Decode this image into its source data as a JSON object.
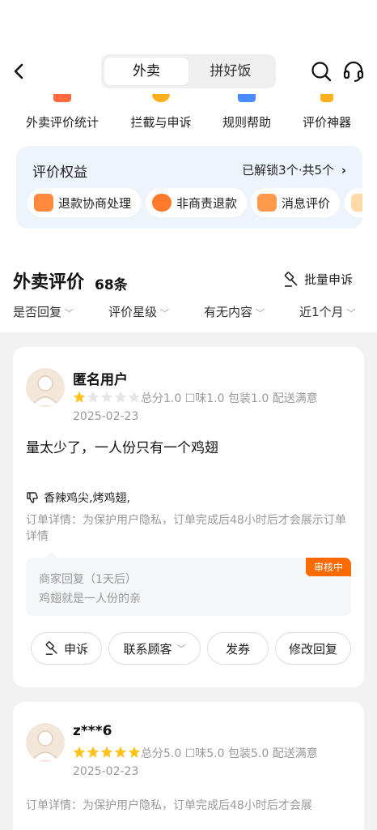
{
  "header": {
    "tabs": [
      {
        "label": "外卖",
        "active": true
      },
      {
        "label": "拼好饭",
        "active": false
      }
    ]
  },
  "quick_links": [
    {
      "label": "外卖评价统计",
      "icon": "stats-icon",
      "color": "#ff6a3d"
    },
    {
      "label": "拦截与申诉",
      "icon": "shield-icon",
      "color": "#ffb020"
    },
    {
      "label": "规则帮助",
      "icon": "book-icon",
      "color": "#4a8cff"
    },
    {
      "label": "评价神器",
      "icon": "star-icon",
      "color": "#ffb020"
    }
  ],
  "benefits": {
    "title": "评价权益",
    "status": "已解锁3个·共5个",
    "chips": [
      {
        "label": "退款协商处理",
        "icon": "refund-negotiation-icon"
      },
      {
        "label": "非商责退款",
        "icon": "refund-icon"
      },
      {
        "label": "消息评价",
        "icon": "message-icon"
      }
    ]
  },
  "section": {
    "title": "外卖评价",
    "count": "68条",
    "batch_label": "批量申诉"
  },
  "filters": [
    "是否回复",
    "评价星级",
    "有无内容",
    "近1个月"
  ],
  "reviews": [
    {
      "user": "匿名用户",
      "rating": 1,
      "scores": "总分1.0   ☐味1.0   包装1.0   配送满意",
      "date": "2025-02-23",
      "content": "量太少了，一人份只有一个鸡翅",
      "dislike": "香辣鸡尖,烤鸡翅,",
      "order_detail": "订单详情：为保护用户隐私，订单完成后48小时后才会展示订单详情",
      "reply": {
        "title": "商家回复（1天后）",
        "text": "鸡翅就是一人份的亲",
        "badge": "审核中"
      },
      "actions": {
        "appeal": "申诉",
        "contact": "联系顾客",
        "coupon": "发券",
        "edit_reply": "修改回复"
      }
    },
    {
      "user": "z***6",
      "rating": 5,
      "scores": "总分5.0   ☐味5.0   包装5.0   配送满意",
      "date": "2025-02-23",
      "order_detail": "订单详情：为保护用户隐私，订单完成后48小时后才会展"
    }
  ],
  "colors": {
    "accent": "#ff6a00",
    "star": "#ffc21a",
    "benefit_bg": "#eef4fb"
  }
}
